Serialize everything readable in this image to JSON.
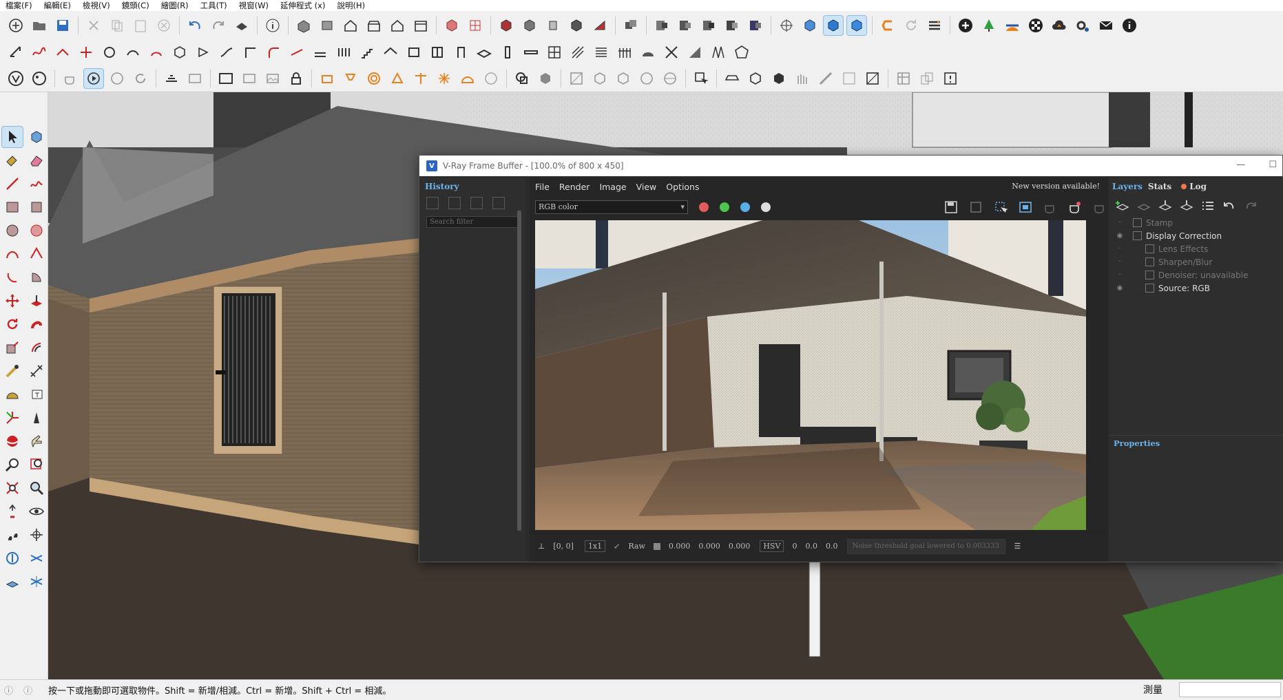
{
  "menu": [
    "檔案(F)",
    "編輯(E)",
    "檢視(V)",
    "鏡頭(C)",
    "繪圖(R)",
    "工具(T)",
    "視窗(W)",
    "延伸程式 (x)",
    "說明(H)"
  ],
  "toolbar_icons_row1": [
    "new-icon",
    "open-icon",
    "save-icon",
    "cut-icon",
    "copy-icon",
    "paste-icon",
    "erase-icon",
    "undo-icon",
    "redo-icon",
    "print-icon",
    "model-info-icon",
    "iso-view-icon",
    "top-view-icon",
    "front-view-icon",
    "right-view-icon",
    "back-view-icon",
    "left-view-icon",
    "xray-icon",
    "wireframe-icon",
    "hidden-line-icon",
    "shaded-icon",
    "textured-icon",
    "monochrome-icon",
    "component-icon",
    "group-icon",
    "section-plane-icon",
    "section-display-icon",
    "section-fill-icon",
    "orbit-icon",
    "vray-asset-icon",
    "vray-render-icon",
    "vray-interactive-icon",
    "enscape-icon",
    "refresh-icon",
    "layers-icon",
    "add-icon",
    "tree-icon",
    "sun-icon",
    "checker-icon",
    "cloud-upload-icon",
    "settings-icon",
    "mail-icon",
    "info-icon"
  ],
  "status": {
    "hint": "按一下或拖動即可選取物件。Shift = 新增/相減。Ctrl = 新增。Shift + Ctrl = 相減。",
    "measure_label": "測量"
  },
  "vfb": {
    "title": "V-Ray Frame Buffer - [100.0% of 800 x 450]",
    "history_title": "History",
    "search_placeholder": "Search filter",
    "menu": [
      "File",
      "Render",
      "Image",
      "View",
      "Options"
    ],
    "notice": "New version available!",
    "channel": "RGB color",
    "colors": {
      "red": "#e05b5b",
      "green": "#4cc64c",
      "blue": "#58aee8",
      "accent": "#6cb3ea"
    },
    "status": {
      "coords": "[0, 0]",
      "zoom": "1x1",
      "raw_label": "Raw",
      "r": "0.000",
      "g": "0.000",
      "b": "0.000",
      "color_model": "HSV",
      "h": "0",
      "s": "0.0",
      "v": "0.0",
      "noise_text": "Noise threshold goal lowered to 0.003333"
    },
    "tabs": {
      "layers": "Layers",
      "stats": "Stats",
      "log": "Log"
    },
    "layers": [
      {
        "name": "Stamp",
        "dim": true,
        "indent": false,
        "eye": false
      },
      {
        "name": "Display Correction",
        "dim": false,
        "indent": false,
        "eye": true
      },
      {
        "name": "Lens Effects",
        "dim": true,
        "indent": true,
        "eye": false
      },
      {
        "name": "Sharpen/Blur",
        "dim": true,
        "indent": true,
        "eye": false
      },
      {
        "name": "Denoiser: unavailable",
        "dim": true,
        "indent": true,
        "eye": false
      },
      {
        "name": "Source: RGB",
        "dim": false,
        "indent": true,
        "eye": true
      }
    ],
    "properties_title": "Properties"
  }
}
